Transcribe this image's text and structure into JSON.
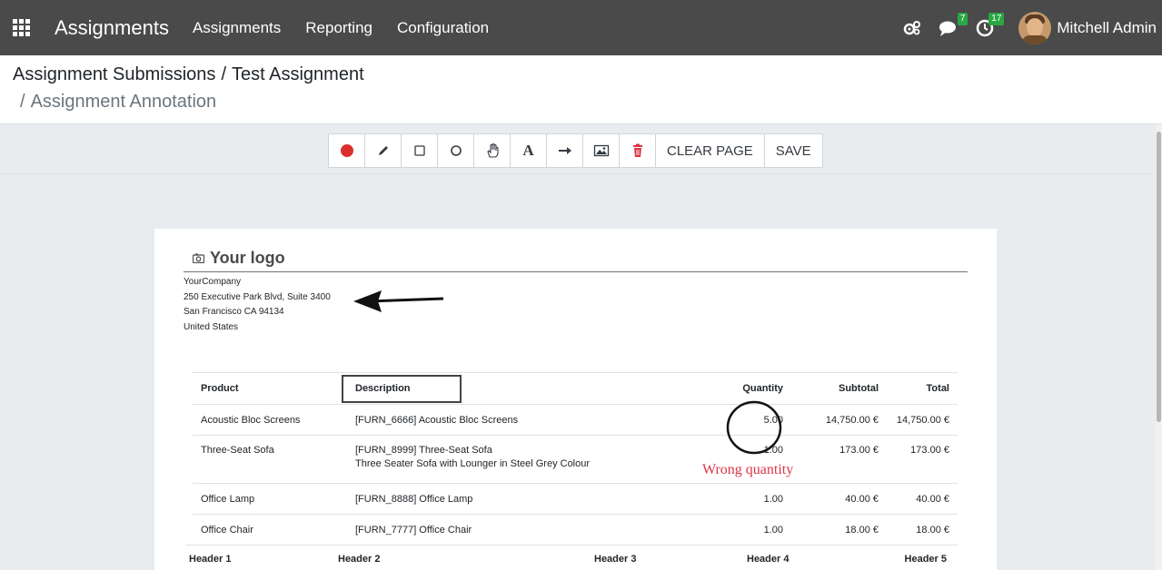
{
  "navbar": {
    "brand": "Assignments",
    "menu": [
      "Assignments",
      "Reporting",
      "Configuration"
    ],
    "messages_count": "7",
    "activities_count": "17",
    "user_name": "Mitchell Admin"
  },
  "breadcrumb": {
    "items": [
      "Assignment Submissions",
      "Test Assignment",
      "Assignment Annotation"
    ],
    "separator": "/"
  },
  "toolbar": {
    "tools": [
      "record-icon",
      "pencil-icon",
      "square-icon",
      "circle-icon",
      "hand-icon",
      "text-icon",
      "arrow-icon",
      "image-icon",
      "trash-icon"
    ],
    "text_tool_glyph": "A",
    "clear_label": "CLEAR PAGE",
    "save_label": "SAVE",
    "colors": {
      "record": "#d9302c",
      "trash": "#dc3545"
    }
  },
  "document": {
    "logo_text": "Your logo",
    "company": {
      "name": "YourCompany",
      "street": "250 Executive Park Blvd, Suite 3400",
      "city": "San Francisco CA 94134",
      "country": "United States"
    },
    "table": {
      "headers": [
        "Product",
        "Description",
        "Quantity",
        "Subtotal",
        "Total"
      ],
      "rows": [
        {
          "product": "Acoustic Bloc Screens",
          "description": "[FURN_6666] Acoustic Bloc Screens",
          "description2": "",
          "quantity": "5.00",
          "subtotal": "14,750.00 €",
          "total": "14,750.00 €"
        },
        {
          "product": "Three-Seat Sofa",
          "description": "[FURN_8999] Three-Seat Sofa",
          "description2": "Three Seater Sofa with Lounger in Steel Grey Colour",
          "quantity": "1.00",
          "subtotal": "173.00 €",
          "total": "173.00 €"
        },
        {
          "product": "Office Lamp",
          "description": "[FURN_8888] Office Lamp",
          "description2": "",
          "quantity": "1.00",
          "subtotal": "40.00 €",
          "total": "40.00 €"
        },
        {
          "product": "Office Chair",
          "description": "[FURN_7777] Office Chair",
          "description2": "",
          "quantity": "1.00",
          "subtotal": "18.00 €",
          "total": "18.00 €"
        }
      ],
      "sub_headers": [
        "Header 1",
        "Header 2",
        "Header 3",
        "Header 4",
        "Header 5"
      ]
    }
  },
  "annotations": {
    "note": "Wrong quantity",
    "note_color": "#dc3545"
  }
}
